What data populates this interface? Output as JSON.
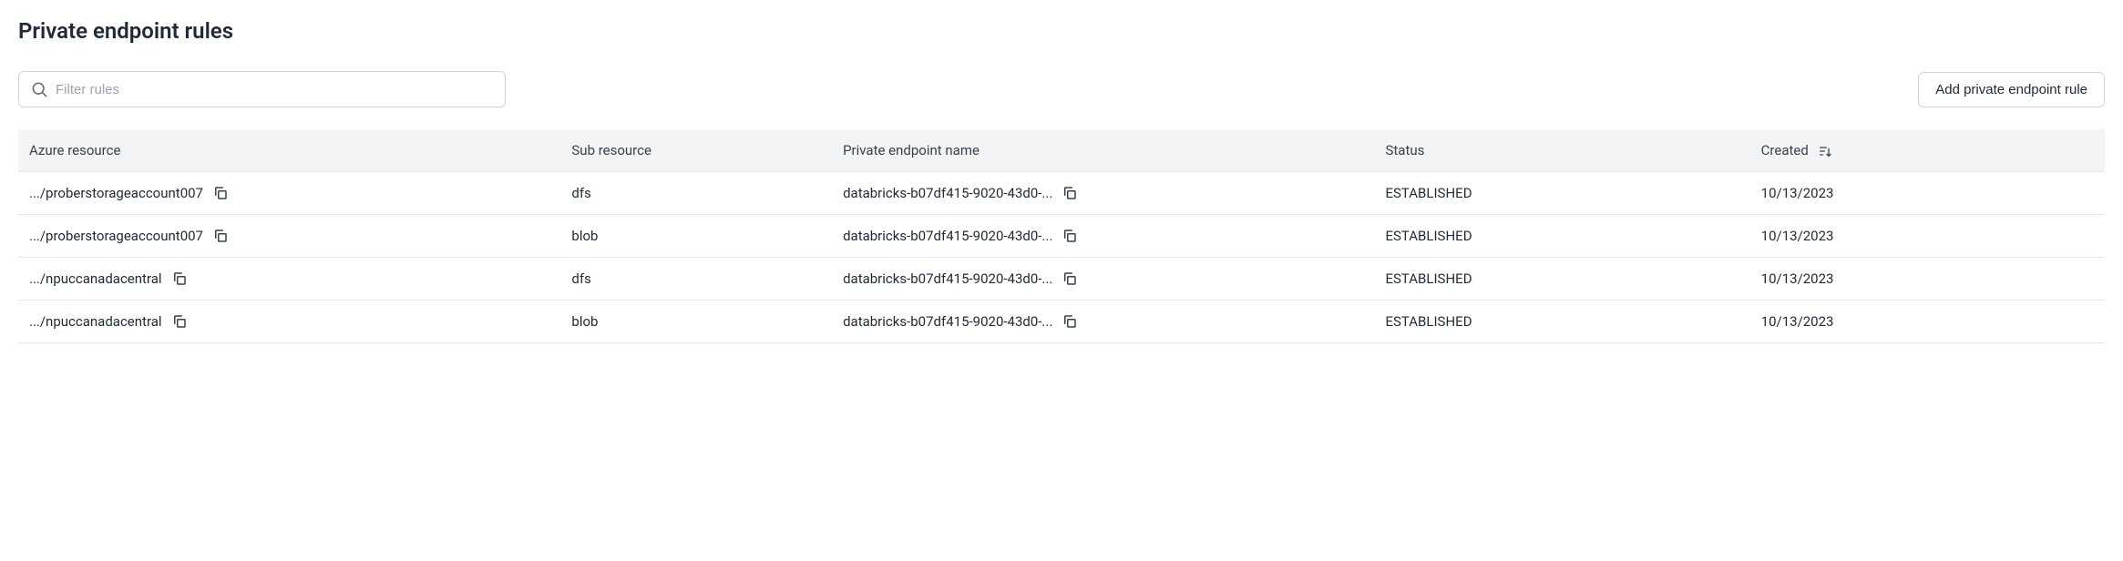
{
  "header": {
    "title": "Private endpoint rules"
  },
  "search": {
    "placeholder": "Filter rules"
  },
  "actions": {
    "add_label": "Add private endpoint rule"
  },
  "columns": {
    "azure_resource": "Azure resource",
    "sub_resource": "Sub resource",
    "endpoint_name": "Private endpoint name",
    "status": "Status",
    "created": "Created"
  },
  "rows": [
    {
      "azure_resource": ".../proberstorageaccount007",
      "sub_resource": "dfs",
      "endpoint_name": "databricks-b07df415-9020-43d0-...",
      "status": "ESTABLISHED",
      "created": "10/13/2023"
    },
    {
      "azure_resource": ".../proberstorageaccount007",
      "sub_resource": "blob",
      "endpoint_name": "databricks-b07df415-9020-43d0-...",
      "status": "ESTABLISHED",
      "created": "10/13/2023"
    },
    {
      "azure_resource": ".../npuccanadacentral",
      "sub_resource": "dfs",
      "endpoint_name": "databricks-b07df415-9020-43d0-...",
      "status": "ESTABLISHED",
      "created": "10/13/2023"
    },
    {
      "azure_resource": ".../npuccanadacentral",
      "sub_resource": "blob",
      "endpoint_name": "databricks-b07df415-9020-43d0-...",
      "status": "ESTABLISHED",
      "created": "10/13/2023"
    }
  ]
}
